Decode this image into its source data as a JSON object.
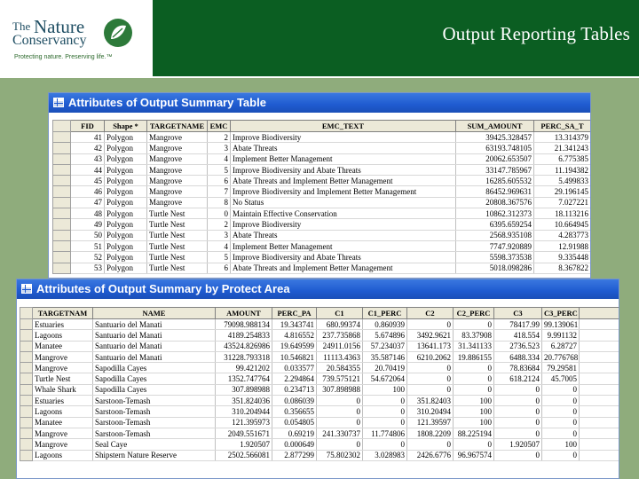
{
  "header": {
    "title": "Output Reporting Tables",
    "logo": {
      "the": "The",
      "nature": "Nature",
      "conservancy": "Conservancy",
      "tagline": "Protecting nature. Preserving life.™"
    },
    "colors": {
      "bar": "#0b5e22",
      "panel": "#8fac7c",
      "titlebar": "#1f5bd0"
    }
  },
  "summary_table": {
    "title": "Attributes of Output Summary Table",
    "columns": [
      "FID",
      "Shape *",
      "TARGETNAME",
      "EMC",
      "EMC_TEXT",
      "SUM_AMOUNT",
      "PERC_SA_T"
    ],
    "rows": [
      [
        "41",
        "Polygon",
        "Mangrove",
        "2",
        "Improve Biodiversity",
        "39425.328457",
        "13.314379"
      ],
      [
        "42",
        "Polygon",
        "Mangrove",
        "3",
        "Abate Threats",
        "63193.748105",
        "21.341243"
      ],
      [
        "43",
        "Polygon",
        "Mangrove",
        "4",
        "Implement Better Management",
        "20062.653507",
        "6.775385"
      ],
      [
        "44",
        "Polygon",
        "Mangrove",
        "5",
        "Improve Biodiversity and Abate Threats",
        "33147.785967",
        "11.194382"
      ],
      [
        "45",
        "Polygon",
        "Mangrove",
        "6",
        "Abate Threats and Implement Better Management",
        "16285.605532",
        "5.499833"
      ],
      [
        "46",
        "Polygon",
        "Mangrove",
        "7",
        "Improve Biodiversity and Implement Better Management",
        "86452.969631",
        "29.196145"
      ],
      [
        "47",
        "Polygon",
        "Mangrove",
        "8",
        "No Status",
        "20808.367576",
        "7.027221"
      ],
      [
        "48",
        "Polygon",
        "Turtle Nest",
        "0",
        "Maintain Effective Conservation",
        "10862.312373",
        "18.113216"
      ],
      [
        "49",
        "Polygon",
        "Turtle Nest",
        "2",
        "Improve Biodiversity",
        "6395.659254",
        "10.664945"
      ],
      [
        "50",
        "Polygon",
        "Turtle Nest",
        "3",
        "Abate Threats",
        "2568.935108",
        "4.283773"
      ],
      [
        "51",
        "Polygon",
        "Turtle Nest",
        "4",
        "Implement Better Management",
        "7747.920889",
        "12.91988"
      ],
      [
        "52",
        "Polygon",
        "Turtle Nest",
        "5",
        "Improve Biodiversity and Abate Threats",
        "5598.373538",
        "9.335448"
      ],
      [
        "53",
        "Polygon",
        "Turtle Nest",
        "6",
        "Abate Threats and Implement Better Management",
        "5018.098286",
        "8.367822"
      ]
    ]
  },
  "protect_table": {
    "title": "Attributes of Output Summary by Protect Area",
    "columns": [
      "TARGETNAM",
      "NAME",
      "AMOUNT",
      "PERC_PA",
      "C1",
      "C1_PERC",
      "C2",
      "C2_PERC",
      "C3",
      "C3_PERC"
    ],
    "rows": [
      [
        "Estuaries",
        "Santuario del Manati",
        "79098.988134",
        "19.343741",
        "680.99374",
        "0.860939",
        "0",
        "0",
        "78417.99",
        "99.139061"
      ],
      [
        "Lagoons",
        "Santuario del Manati",
        "4189.254833",
        "4.816552",
        "237.735868",
        "5.674896",
        "3492.9621",
        "83.37908",
        "418.554",
        "9.991132"
      ],
      [
        "Manatee",
        "Santuario del Manati",
        "43524.826986",
        "19.649599",
        "24911.0156",
        "57.234037",
        "13641.173",
        "31.341133",
        "2736.523",
        "6.28727"
      ],
      [
        "Mangrove",
        "Santuario del Manati",
        "31228.793318",
        "10.546821",
        "11113.4363",
        "35.587146",
        "6210.2062",
        "19.886155",
        "6488.334",
        "20.776768"
      ],
      [
        "Mangrove",
        "Sapodilla Cayes",
        "99.421202",
        "0.033577",
        "20.584355",
        "20.70419",
        "0",
        "0",
        "78.83684",
        "79.29581"
      ],
      [
        "Turtle Nest",
        "Sapodilla Cayes",
        "1352.747764",
        "2.294864",
        "739.575121",
        "54.672064",
        "0",
        "0",
        "618.2124",
        "45.7005"
      ],
      [
        "Whale Shark",
        "Sapodilla Cayes",
        "307.898988",
        "0.234713",
        "307.898988",
        "100",
        "0",
        "0",
        "0",
        "0"
      ],
      [
        "Estuaries",
        "Sarstoon-Temash",
        "351.824036",
        "0.086039",
        "0",
        "0",
        "351.82403",
        "100",
        "0",
        "0"
      ],
      [
        "Lagoons",
        "Sarstoon-Temash",
        "310.204944",
        "0.356655",
        "0",
        "0",
        "310.20494",
        "100",
        "0",
        "0"
      ],
      [
        "Manatee",
        "Sarstoon-Temash",
        "121.395973",
        "0.054805",
        "0",
        "0",
        "121.39597",
        "100",
        "0",
        "0"
      ],
      [
        "Mangrove",
        "Sarstoon-Temash",
        "2049.551671",
        "0.69219",
        "241.330737",
        "11.774806",
        "1808.2209",
        "88.225194",
        "0",
        "0"
      ],
      [
        "Mangrove",
        "Seal Caye",
        "1.920507",
        "0.000649",
        "0",
        "0",
        "0",
        "0",
        "1.920507",
        "100"
      ],
      [
        "Lagoons",
        "Shipstern Nature Reserve",
        "2502.566081",
        "2.877299",
        "75.802302",
        "3.028983",
        "2426.6776",
        "96.967574",
        "0",
        "0"
      ]
    ]
  }
}
